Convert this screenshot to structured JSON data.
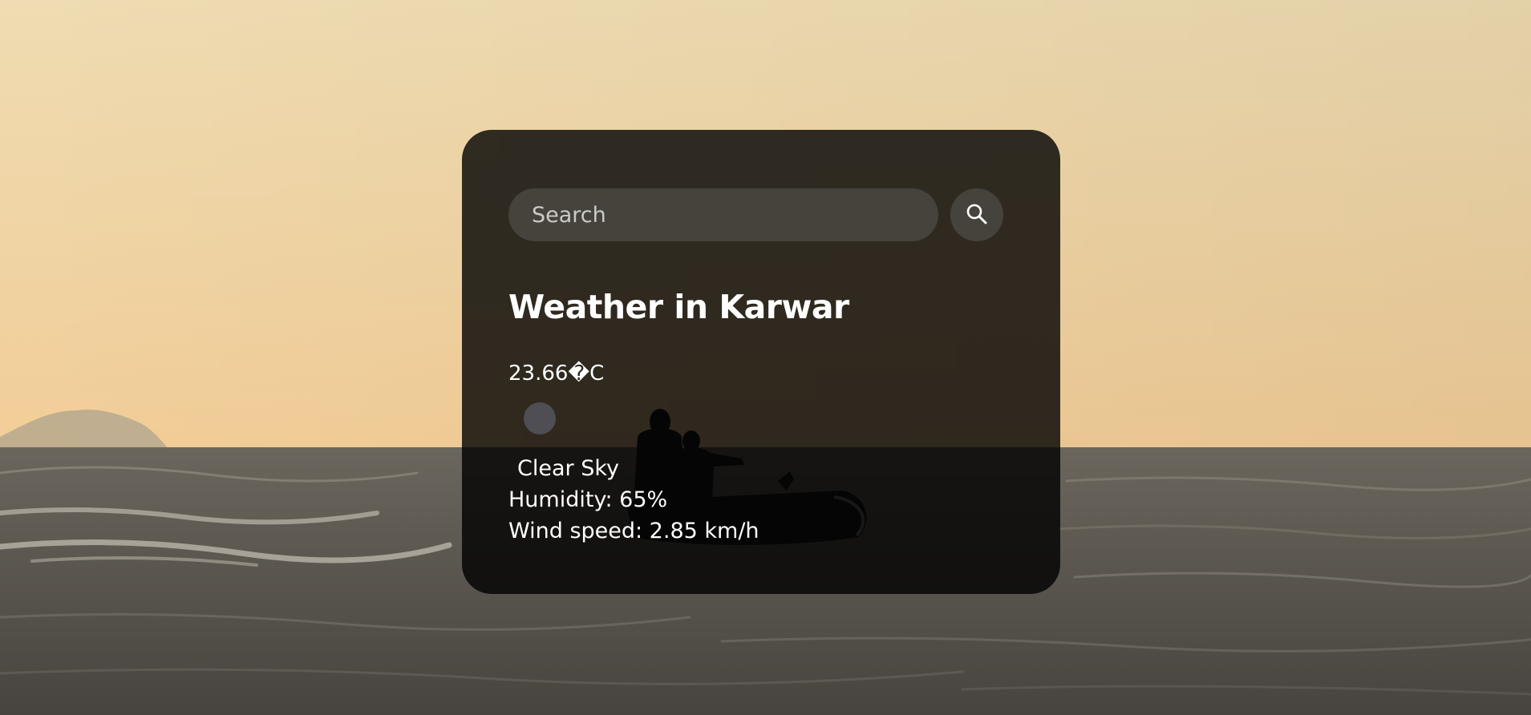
{
  "search": {
    "placeholder": "Search",
    "icon": "search-icon"
  },
  "weather": {
    "title": "Weather in Karwar",
    "temperature": "23.66�C",
    "icon": "weather-condition-icon",
    "description": "Clear Sky",
    "humidity": "Humidity: 65%",
    "wind": "Wind speed: 2.85 km/h"
  },
  "colors": {
    "card_background": "rgba(0,0,0,0.8)",
    "input_background": "rgba(125,125,125,0.3)",
    "text": "#ffffff",
    "sky_top": "#f0ddb0",
    "sky_horizon": "#f2cf9b",
    "sea": "#5a5650"
  }
}
